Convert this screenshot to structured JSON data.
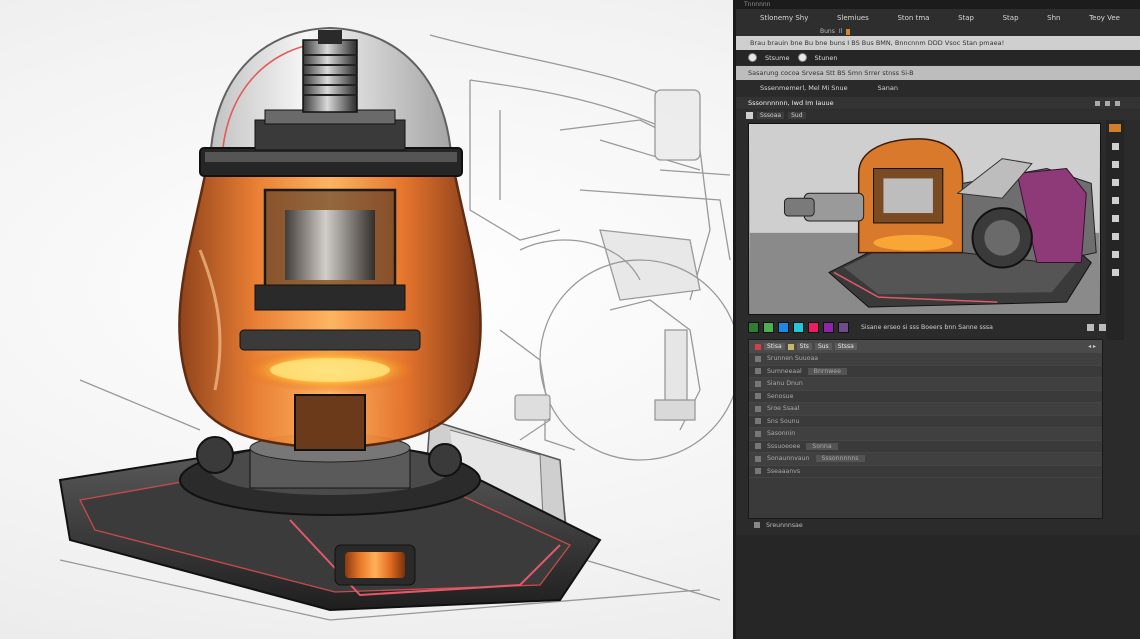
{
  "app": {
    "title": "Tnnnnnn",
    "menu": [
      "Stlonemy Shy",
      "Slemiues",
      "Ston tma",
      "Stap",
      "Stap",
      "Shn",
      "Teoy Vee"
    ],
    "subtabs": [
      "Buns",
      "Il"
    ],
    "toolbar1": "Brau brauin bne  Bu  bne buns I  BS  Bus BMN, Bnncnnm DDD  Vsoc  Stan pmaea!",
    "toolbar2": {
      "item1": "Stsume",
      "item2": "Stunen"
    },
    "toolbar3": "Sasarung cocoa Srvesa Stt  BS  Smn  Srrer stnss Si-B",
    "panelstrip": [
      "Sssenmemerl, Mel Mi  Snue",
      "Sanan"
    ],
    "doc": {
      "title": "Sssonnnnnn, Iwd Im Iauue",
      "tabs": [
        "Sssoaa",
        "Sud"
      ]
    },
    "swatch_caption": "Sisane erseo si sss Boeers bnn Sanne sssa",
    "swatch_colors": [
      "#2e7d32",
      "#4caf50",
      "#1e88e5",
      "#26c6da",
      "#e91e63",
      "#8e24aa",
      "#6d4c8c"
    ],
    "layers": {
      "tabs": [
        "Stisa",
        "Sts",
        "Sus",
        "Stssa"
      ],
      "rows": [
        {
          "left": "Srunnen Suuoaa",
          "right": ""
        },
        {
          "left": "Sumneeaal",
          "right": "Bnrnwee"
        },
        {
          "left": "Sianu Dnun",
          "right": ""
        },
        {
          "left": "Senosue",
          "right": ""
        },
        {
          "left": "Sroe Ssaal",
          "right": ""
        },
        {
          "left": "Sns Sounu",
          "right": ""
        },
        {
          "left": "Sasonnin",
          "right": ""
        },
        {
          "left": "Sssuoeoee",
          "right": "Sonna"
        },
        {
          "left": "Sonaunnvaun",
          "right": "Sssonnnnns"
        },
        {
          "left": "Sseaaanvs",
          "right": ""
        }
      ],
      "footer": "Sreunnnsae"
    }
  }
}
